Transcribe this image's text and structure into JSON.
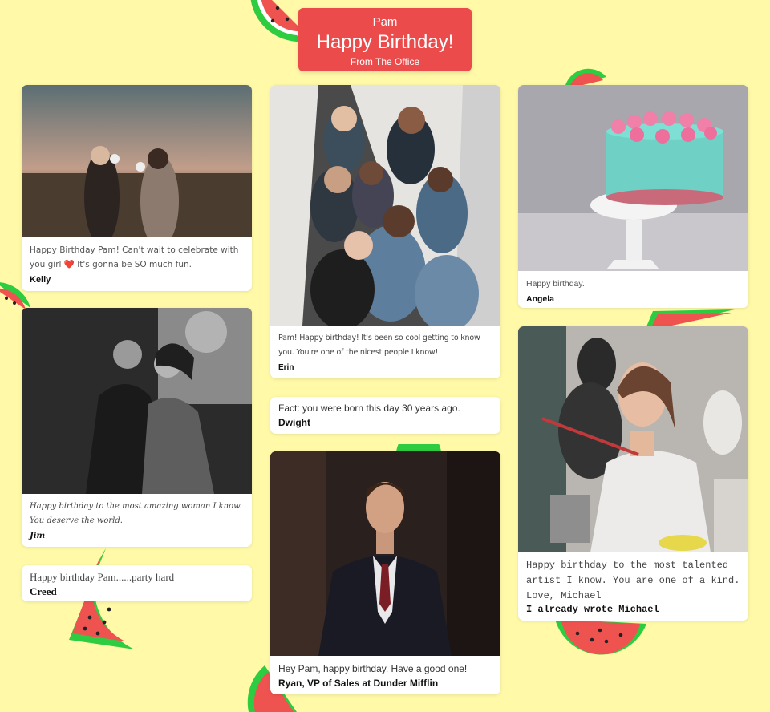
{
  "header": {
    "recipient": "Pam",
    "title": "Happy Birthday!",
    "subtitle": "From The Office"
  },
  "cards": {
    "kelly": {
      "message": "Happy Birthday Pam! Can't wait to celebrate with you girl ❤️ It's gonna be SO much fun.",
      "signature": "Kelly",
      "photo": "two-friends-taking-photos-at-sunset"
    },
    "jim": {
      "message": "Happy birthday to the most amazing woman I know. You deserve the world.",
      "signature": "Jim",
      "photo": "couple-embracing-black-and-white"
    },
    "creed": {
      "message": "Happy birthday Pam......party hard",
      "signature": "Creed"
    },
    "erin": {
      "message": "Pam! Happy birthday! It's been so cool getting to know you. You're one of the nicest people I know!",
      "signature": "Erin",
      "photo": "group-of-women-on-stairs"
    },
    "dwight": {
      "message": "Fact: you were born this day 30 years ago.",
      "signature": "Dwight"
    },
    "ryan": {
      "message": "Hey Pam, happy birthday. Have a good one!",
      "signature": "Ryan, VP of Sales at Dunder Mifflin",
      "photo": "man-in-suit-portrait"
    },
    "angela": {
      "message": "Happy birthday.",
      "signature": "Angela",
      "photo": "mint-birthday-cake-on-stand"
    },
    "michael": {
      "message": "Happy birthday to the most talented artist I know. You are one of a kind. Love, Michael",
      "signature": "I already wrote Michael",
      "photo": "artist-woman-holding-paintbrush"
    }
  },
  "theme": {
    "background": "#fff9a8",
    "header_color": "#ec4b4b",
    "melon_red": "#ef5350",
    "melon_green": "#2ecc40"
  }
}
